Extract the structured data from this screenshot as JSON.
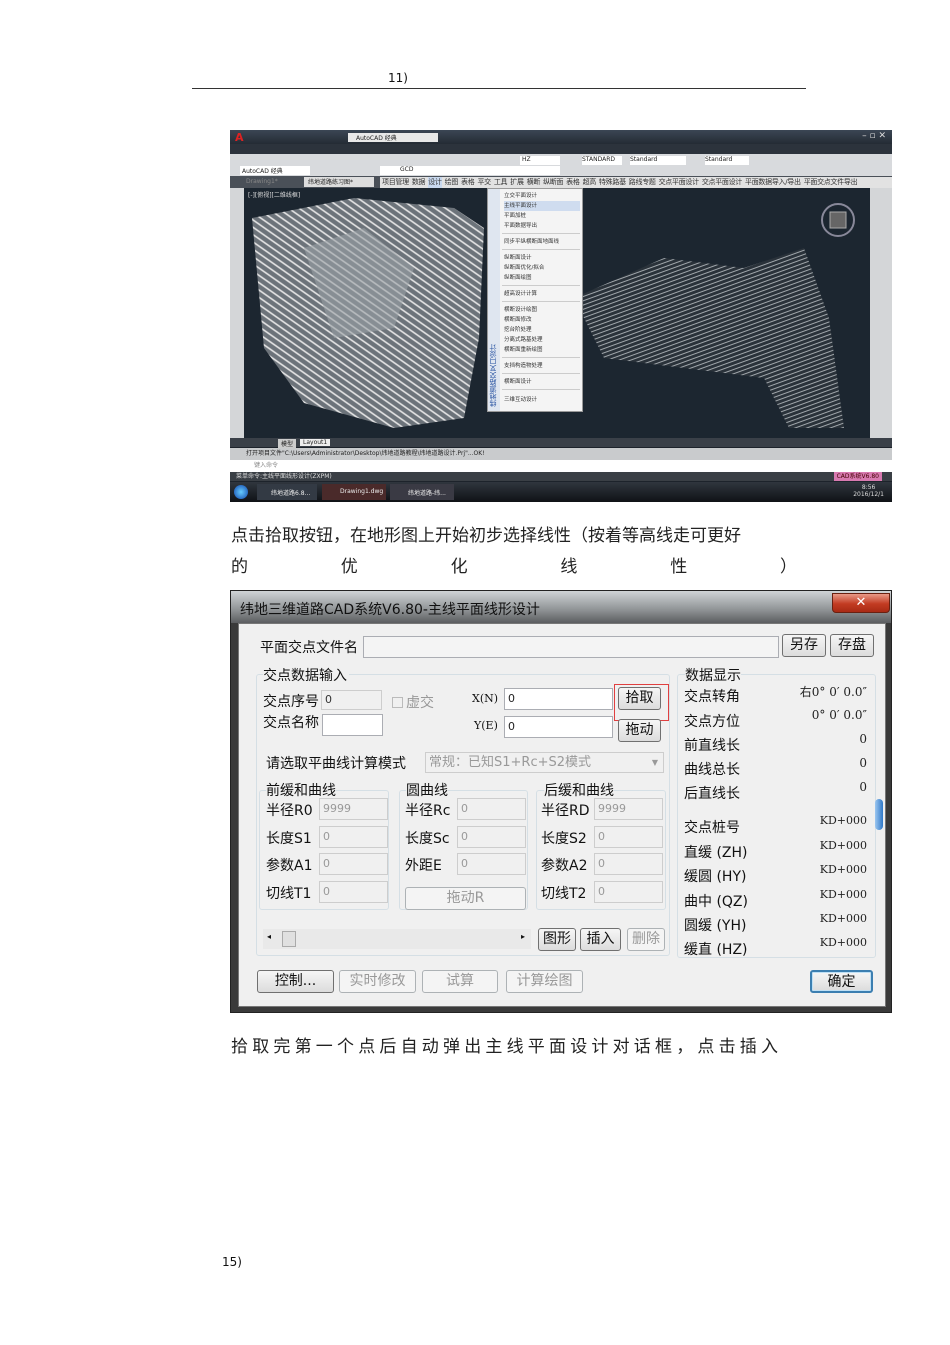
{
  "page": {
    "header_number": "11)",
    "footer_number": "15)"
  },
  "cad": {
    "app_title": "AutoCAD 经典",
    "workspace": "AutoCAD 经典",
    "layer": "GCD",
    "text_style": "HZ",
    "dim_style": "STANDARD",
    "table_style": "Standard",
    "mleader_style": "Standard",
    "tabs": [
      "Drawing1*",
      "纬地道路练习图*"
    ],
    "viewport_label": "[-][俯视][二维线框]",
    "layout_tabs": [
      "模型",
      "Layout1"
    ],
    "menu_bar": [
      "项目管理",
      "数据",
      "设计",
      "绘图",
      "表格",
      "平交",
      "工具",
      "扩展",
      "横断",
      "纵断面",
      "表格",
      "超高",
      "特殊路基",
      "路线专题",
      "交点平面设计",
      "交点平面设计",
      "平面数据导入/导出",
      "平面交点文件导出"
    ],
    "menu_side_label": "纬地道路交叉口设计",
    "menu_items": [
      "立交平面设计",
      "主线平面设计",
      "平面加桩",
      "平面数据导出",
      "同步平纵横断面地面线",
      "纵断面设计",
      "纵断面优化/拟合",
      "纵断面绘图",
      "超高设计计算",
      "横断设计绘图",
      "横断面修改",
      "挖台阶处理",
      "分离式路基处理",
      "横断面重新绘图",
      "支挡构造物处理",
      "横断面设计",
      "三维互动设计"
    ],
    "command_line": "打开项目文件\"C:\\Users\\Administrator\\Desktop\\纬地道路教程\\纬地道路设计.Prj\"...OK!",
    "command_prompt": "键入命令",
    "status_text": "菜单命令:主线平面线形设计(ZXPM)",
    "brand_badge": "CAD系统V6.80",
    "taskbar": [
      "纬地道路6.8...",
      "Drawing1.dwg",
      "纬地道路-纬..."
    ],
    "clock": {
      "time": "8:56",
      "date": "2016/12/1"
    }
  },
  "text": {
    "para1_line1": "点击拾取按钮，在地形图上开始初步选择线性（按着等高线走可更好",
    "para1_line2": [
      "的",
      "优",
      "化",
      "线",
      "性",
      "）"
    ],
    "para2": "拾取完第一个点后自动弹出主线平面设计对话框，点击插入"
  },
  "dialog": {
    "title": "纬地三维道路CAD系统V6.80-主线平面线形设计",
    "close_label": "✕",
    "file_label": "平面交点文件名",
    "file_value": "",
    "save_as": "另存",
    "save": "存盘",
    "input_group": "交点数据输入",
    "index_label": "交点序号",
    "index_value": "0",
    "virtual_label": "虚交",
    "name_label": "交点名称",
    "name_value": "",
    "x_label": "X(N)",
    "x_value": "0",
    "y_label": "Y(E)",
    "y_value": "0",
    "pick": "拾取",
    "drag": "拖动",
    "mode_label": "请选取平曲线计算模式",
    "mode_value": "常规：已知S1+Rc+S2模式",
    "front": {
      "title": "前缓和曲线",
      "rows": [
        {
          "l": "半径R0",
          "v": "9999"
        },
        {
          "l": "长度S1",
          "v": "0"
        },
        {
          "l": "参数A1",
          "v": "0"
        },
        {
          "l": "切线T1",
          "v": "0"
        }
      ]
    },
    "circle": {
      "title": "圆曲线",
      "rows": [
        {
          "l": "半径Rc",
          "v": "0"
        },
        {
          "l": "长度Sc",
          "v": "0"
        },
        {
          "l": "外距E",
          "v": "0"
        }
      ],
      "drag_r": "拖动R"
    },
    "back": {
      "title": "后缓和曲线",
      "rows": [
        {
          "l": "半径RD",
          "v": "9999"
        },
        {
          "l": "长度S2",
          "v": "0"
        },
        {
          "l": "参数A2",
          "v": "0"
        },
        {
          "l": "切线T2",
          "v": "0"
        }
      ]
    },
    "graph": "图形",
    "insert": "插入",
    "delete": "删除",
    "display_group": "数据显示",
    "display": [
      {
        "l": "交点转角",
        "v": "右0° 0′ 0.0″"
      },
      {
        "l": "交点方位",
        "v": "0° 0′ 0.0″"
      },
      {
        "l": "前直线长",
        "v": "0"
      },
      {
        "l": "曲线总长",
        "v": "0"
      },
      {
        "l": "后直线长",
        "v": "0"
      },
      {
        "l": "交点桩号",
        "v": "KD+000"
      },
      {
        "l": "直缓 (ZH)",
        "v": "KD+000"
      },
      {
        "l": "缓圆 (HY)",
        "v": "KD+000"
      },
      {
        "l": "曲中 (QZ)",
        "v": "KD+000"
      },
      {
        "l": "圆缓 (YH)",
        "v": "KD+000"
      },
      {
        "l": "缓直 (HZ)",
        "v": "KD+000"
      }
    ],
    "control": "控制...",
    "realtime": "实时修改",
    "trial": "试算",
    "calc_draw": "计算绘图",
    "ok": "确定",
    "highlight_color": "#e04040"
  }
}
